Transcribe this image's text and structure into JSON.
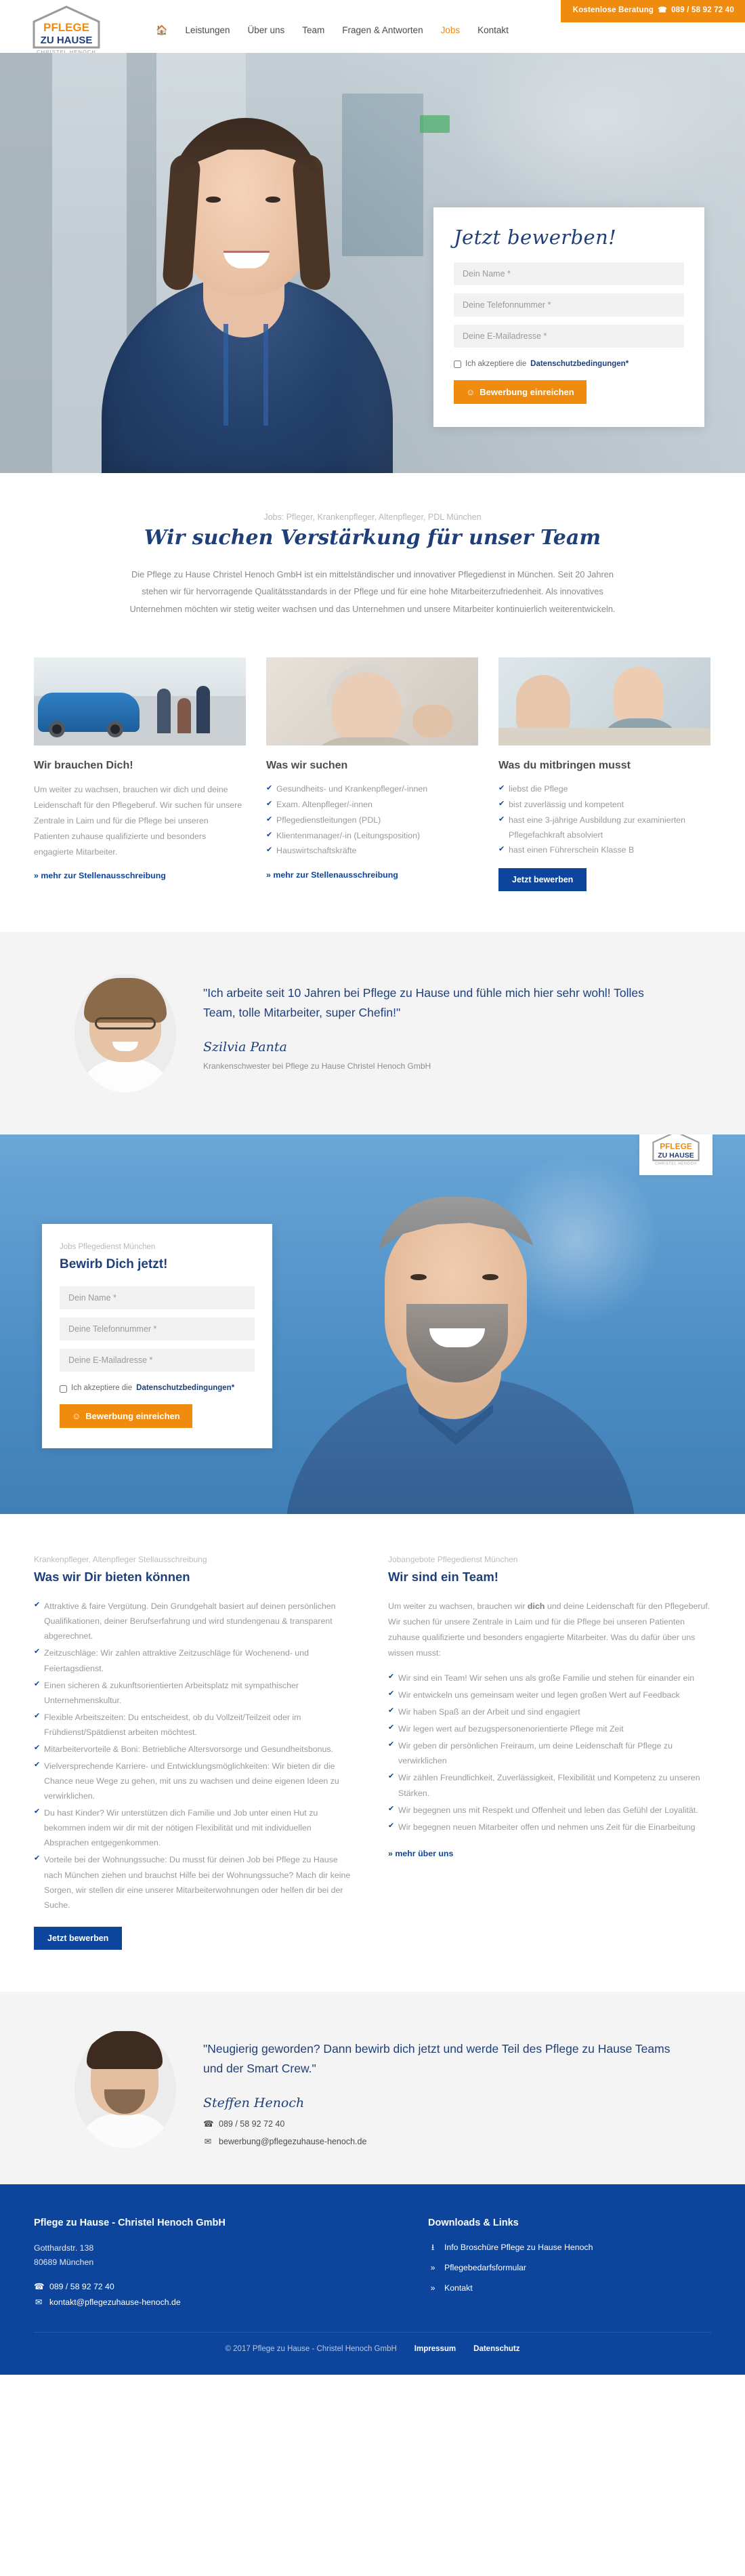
{
  "header": {
    "topbar": {
      "text": "Kostenlose Beratung",
      "phone_icon": "phone-icon",
      "phone": "089 / 58 92 72 40"
    },
    "logo": {
      "line1": "PFLEGE",
      "line2": "ZU HAUSE",
      "line3": "CHRISTEL HENOCH"
    },
    "nav": [
      {
        "label": "",
        "icon": "home-icon",
        "active": false
      },
      {
        "label": "Leistungen",
        "active": false
      },
      {
        "label": "Über uns",
        "active": false
      },
      {
        "label": "Team",
        "active": false
      },
      {
        "label": "Fragen & Antworten",
        "active": false
      },
      {
        "label": "Jobs",
        "active": true
      },
      {
        "label": "Kontakt",
        "active": false
      }
    ]
  },
  "hero_form": {
    "title": "Jetzt bewerben!",
    "name_placeholder": "Dein Name *",
    "phone_placeholder": "Deine Telefonnummer *",
    "email_placeholder": "Deine E-Mailadresse *",
    "consent_prefix": "Ich akzeptiere die",
    "consent_link": "Datenschutzbedingungen*",
    "submit": "Bewerbung einreichen",
    "submit_icon": "smiley-icon"
  },
  "intro": {
    "eyebrow": "Jobs: Pfleger, Krankenpfleger, Altenpfleger, PDL München",
    "title": "Wir suchen Verstärkung für unser Team",
    "body": "Die Pflege zu Hause Christel Henoch GmbH ist ein mittelständischer und innovativer Pflegedienst in München. Seit 20 Jahren stehen wir für hervorragende Qualitätsstandards in der Pflege und für eine hohe Mitarbeiterzufriedenheit. Als innovatives Unternehmen möchten wir stetig weiter wachsen und das Unternehmen und unsere Mitarbeiter kontinuierlich weiterentwickeln."
  },
  "cards": [
    {
      "image": "pflegeauto-mit-familie-foto",
      "title": "Wir brauchen Dich!",
      "body": "Um weiter zu wachsen, brauchen wir dich und deine Leidenschaft für den Pflegeberuf. Wir suchen für unsere Zentrale in Laim und für die Pflege bei unseren Patienten zuhause qualifizierte und besonders engagierte Mitarbeiter.",
      "link": "» mehr zur Stellenausschreibung",
      "items": []
    },
    {
      "image": "seniorin-mit-pflegerin-foto",
      "title": "Was wir suchen",
      "body": "",
      "items": [
        "Gesundheits- und Krankenpfleger/-innen",
        "Exam. Altenpfleger/-innen",
        "Pflegedienstleitungen (PDL)",
        "Klientenmanager/-in (Leitungsposition)",
        "Hauswirtschaftskräfte"
      ],
      "link": "» mehr zur Stellenausschreibung"
    },
    {
      "image": "pflegerin-bei-patientin-foto",
      "title": "Was du mitbringen musst",
      "body": "",
      "items": [
        "liebst die Pflege",
        "bist zuverlässig und kompetent",
        "hast eine 3-jährige Ausbildung zur examinierten Pflegefachkraft absolviert",
        "hast einen Führerschein Klasse B"
      ],
      "button": "Jetzt bewerben"
    }
  ],
  "testimonial1": {
    "avatar": "portrait-szilvia-panta",
    "quote": "\"Ich arbeite seit 10 Jahren bei Pflege zu Hause und fühle mich hier sehr wohl! Tolles Team, tolle Mitarbeiter, super Chefin!\"",
    "name": "Szilvia Panta",
    "role": "Krankenschwester bei Pflege zu Hause Christel Henoch GmbH"
  },
  "hero2_form": {
    "eyebrow": "Jobs Pflegedienst München",
    "title": "Bewirb Dich jetzt!",
    "name_placeholder": "Dein Name *",
    "phone_placeholder": "Deine Telefonnummer *",
    "email_placeholder": "Deine E-Mailadresse *",
    "consent_prefix": "Ich akzeptiere die",
    "consent_link": "Datenschutzbedingungen*",
    "submit": "Bewerbung einreichen",
    "submit_icon": "smiley-icon"
  },
  "benefits_left": {
    "eyebrow": "Krankenpfleger, Altenpfleger Stellausschreibung",
    "title": "Was wir Dir bieten können",
    "items": [
      "Attraktive & faire Vergütung. Dein Grundgehalt basiert auf deinen persönlichen Qualifikationen, deiner Berufserfahrung und wird stundengenau & transparent abgerechnet.",
      "Zeitzuschläge: Wir zahlen attraktive Zeitzuschläge für Wochenend- und Feiertagsdienst.",
      "Einen sicheren & zukunftsorientierten Arbeitsplatz mit sympathischer Unternehmenskultur.",
      "Flexible Arbeitszeiten: Du entscheidest, ob du Vollzeit/Teilzeit oder im Frühdienst/Spätdienst arbeiten möchtest.",
      "Mitarbeitervorteile & Boni: Betriebliche Altersvorsorge und Gesundheitsbonus.",
      "Vielversprechende Karriere- und Entwicklungsmöglichkeiten: Wir bieten dir die Chance neue Wege zu gehen, mit uns zu wachsen und deine eigenen Ideen zu verwirklichen.",
      "Du hast Kinder? Wir unterstützen dich Familie und Job unter einen Hut zu bekommen indem wir dir mit der nötigen Flexibilität und mit individuellen Absprachen entgegenkommen.",
      "Vorteile bei der Wohnungssuche: Du musst für deinen Job bei Pflege zu Hause nach München ziehen und brauchst Hilfe bei der Wohnungssuche? Mach dir keine Sorgen, wir stellen dir eine unserer Mitarbeiterwohnungen oder helfen dir bei der Suche."
    ],
    "button": "Jetzt bewerben"
  },
  "benefits_right": {
    "eyebrow": "Jobangebote Pflegedienst München",
    "title": "Wir sind ein Team!",
    "intro_a": "Um weiter zu wachsen, brauchen wir ",
    "intro_bold": "dich",
    "intro_b": " und deine Leidenschaft für den Pflegeberuf. Wir suchen für unsere Zentrale in Laim und für die Pflege bei unseren Patienten zuhause qualifizierte und besonders engagierte Mitarbeiter. Was du dafür über uns wissen musst:",
    "items": [
      "Wir sind ein Team! Wir sehen uns als große Familie und stehen für einander ein",
      "Wir entwickeln uns gemeinsam weiter und legen großen Wert auf Feedback",
      "Wir haben Spaß an der Arbeit und sind engagiert",
      "Wir legen wert auf bezugspersonenorientierte Pflege mit Zeit",
      "Wir geben dir persönlichen Freiraum, um deine Leidenschaft für Pflege zu verwirklichen",
      "Wir zählen Freundlichkeit, Zuverlässigkeit, Flexibilität und Kompetenz zu unseren Stärken.",
      "Wir begegnen uns mit Respekt und Offenheit und leben das Gefühl der Loyalität.",
      "Wir begegnen neuen Mitarbeiter offen und nehmen uns Zeit für die Einarbeitung"
    ],
    "link": "» mehr über uns"
  },
  "testimonial2": {
    "avatar": "portrait-steffen-henoch",
    "quote": "\"Neugierig geworden? Dann bewirb dich jetzt und werde Teil des Pflege zu Hause Teams und der Smart Crew.\"",
    "name": "Steffen Henoch",
    "phone_icon": "phone-icon",
    "phone": "089 / 58 92 72 40",
    "mail_icon": "envelope-icon",
    "email": "bewerbung@pflegezuhause-henoch.de"
  },
  "footer": {
    "company": "Pflege zu Hause - Christel Henoch GmbH",
    "street": "Gotthardstr. 138",
    "city": "80689 München",
    "phone_icon": "phone-icon",
    "phone": "089 / 58 92 72 40",
    "mail_icon": "envelope-icon",
    "email": "kontakt@pflegezuhause-henoch.de",
    "links_title": "Downloads & Links",
    "links": [
      {
        "icon": "download-icon",
        "label": "Info Broschüre Pflege zu Hause Henoch"
      },
      {
        "icon": "chevron-double-right-icon",
        "label": "Pflegebedarfsformular"
      },
      {
        "icon": "chevron-double-right-icon",
        "label": "Kontakt"
      }
    ],
    "copyright": "© 2017 Pflege zu Hause - Christel Henoch GmbH",
    "impressum": "Impressum",
    "datenschutz": "Datenschutz"
  },
  "colors": {
    "brand_blue": "#0d459c",
    "brand_orange": "#ef8b0e",
    "deep_blue": "#1f3f7a",
    "body_grey": "#9a9a9a"
  }
}
